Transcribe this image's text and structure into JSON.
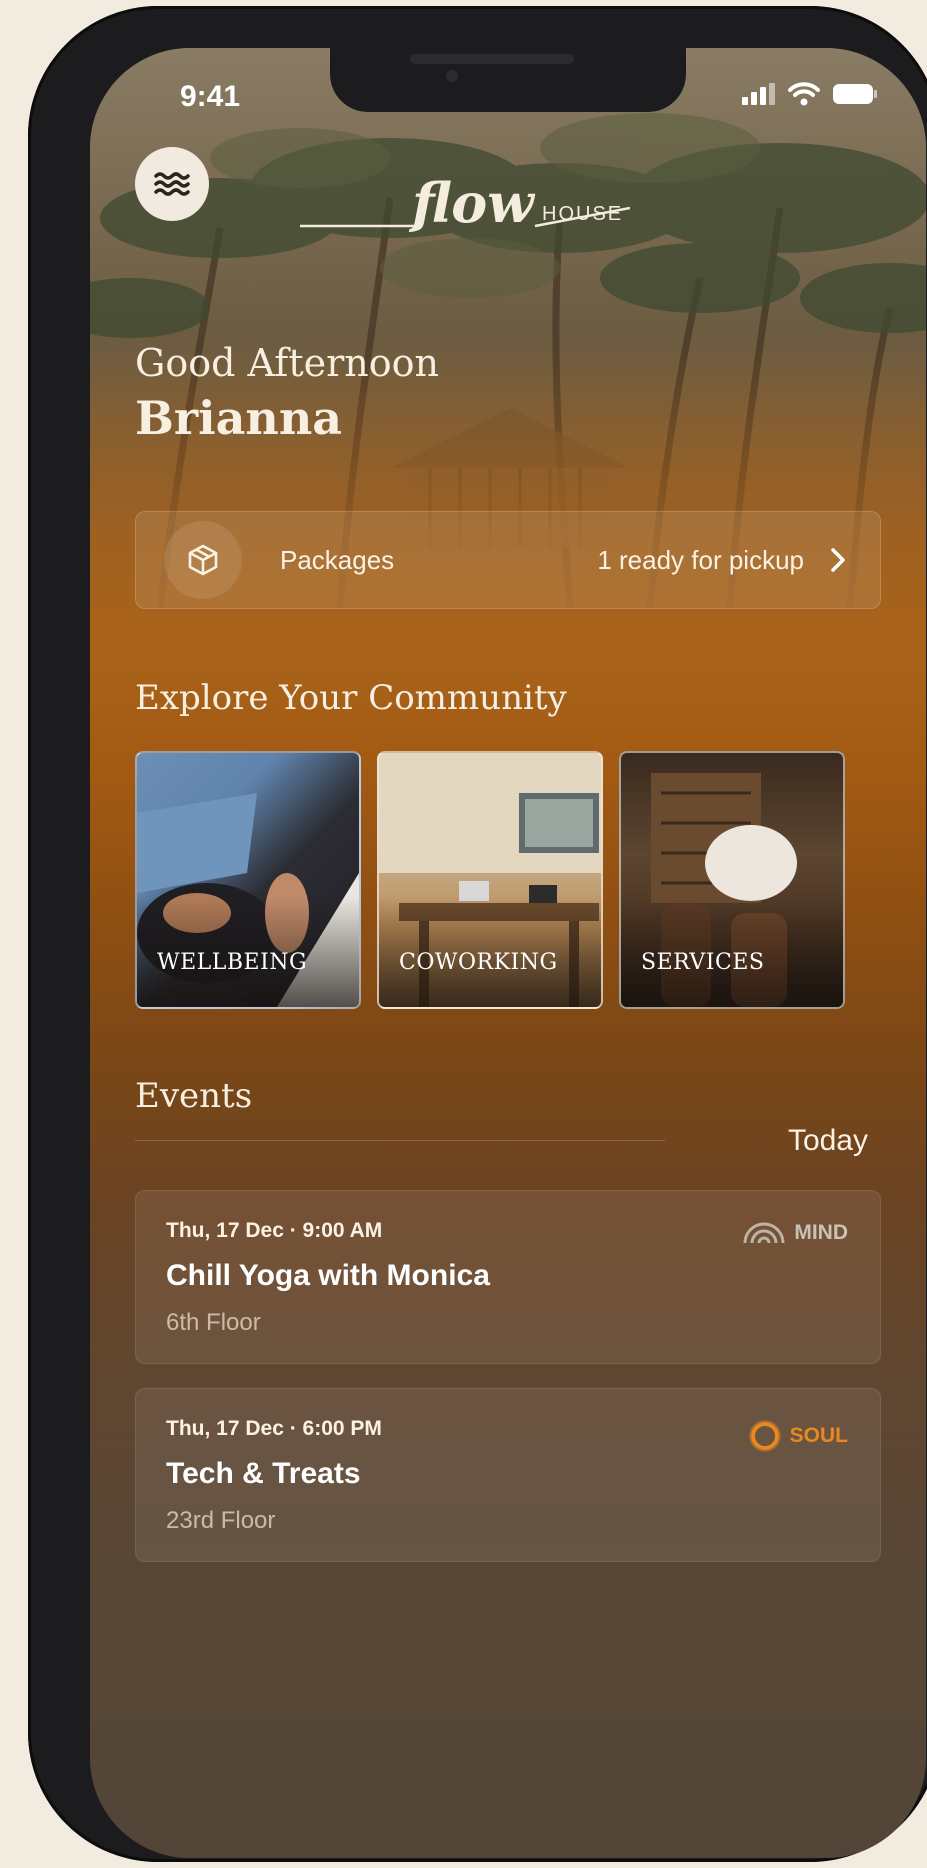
{
  "status_bar": {
    "time": "9:41"
  },
  "header": {
    "logo_script": "flow",
    "logo_word": "HOUSE"
  },
  "greeting": {
    "line1": "Good Afternoon",
    "name": "Brianna"
  },
  "packages": {
    "label": "Packages",
    "status": "1 ready for pickup"
  },
  "explore": {
    "title": "Explore Your Community",
    "tiles": [
      {
        "label": "WELLBEING"
      },
      {
        "label": "COWORKING"
      },
      {
        "label": "SERVICES"
      }
    ]
  },
  "events": {
    "title": "Events",
    "filter": "Today",
    "items": [
      {
        "date": "Thu, 17 Dec · 9:00 AM",
        "title": "Chill Yoga with Monica",
        "place": "6th Floor",
        "tag": "MIND",
        "tag_color": "#c9c2b6"
      },
      {
        "date": "Thu, 17 Dec · 6:00 PM",
        "title": "Tech & Treats",
        "place": "23rd Floor",
        "tag": "SOUL",
        "tag_color": "#e8891f"
      }
    ]
  },
  "colors": {
    "accent_orange": "#a9621a",
    "cream": "#f2ece0"
  }
}
